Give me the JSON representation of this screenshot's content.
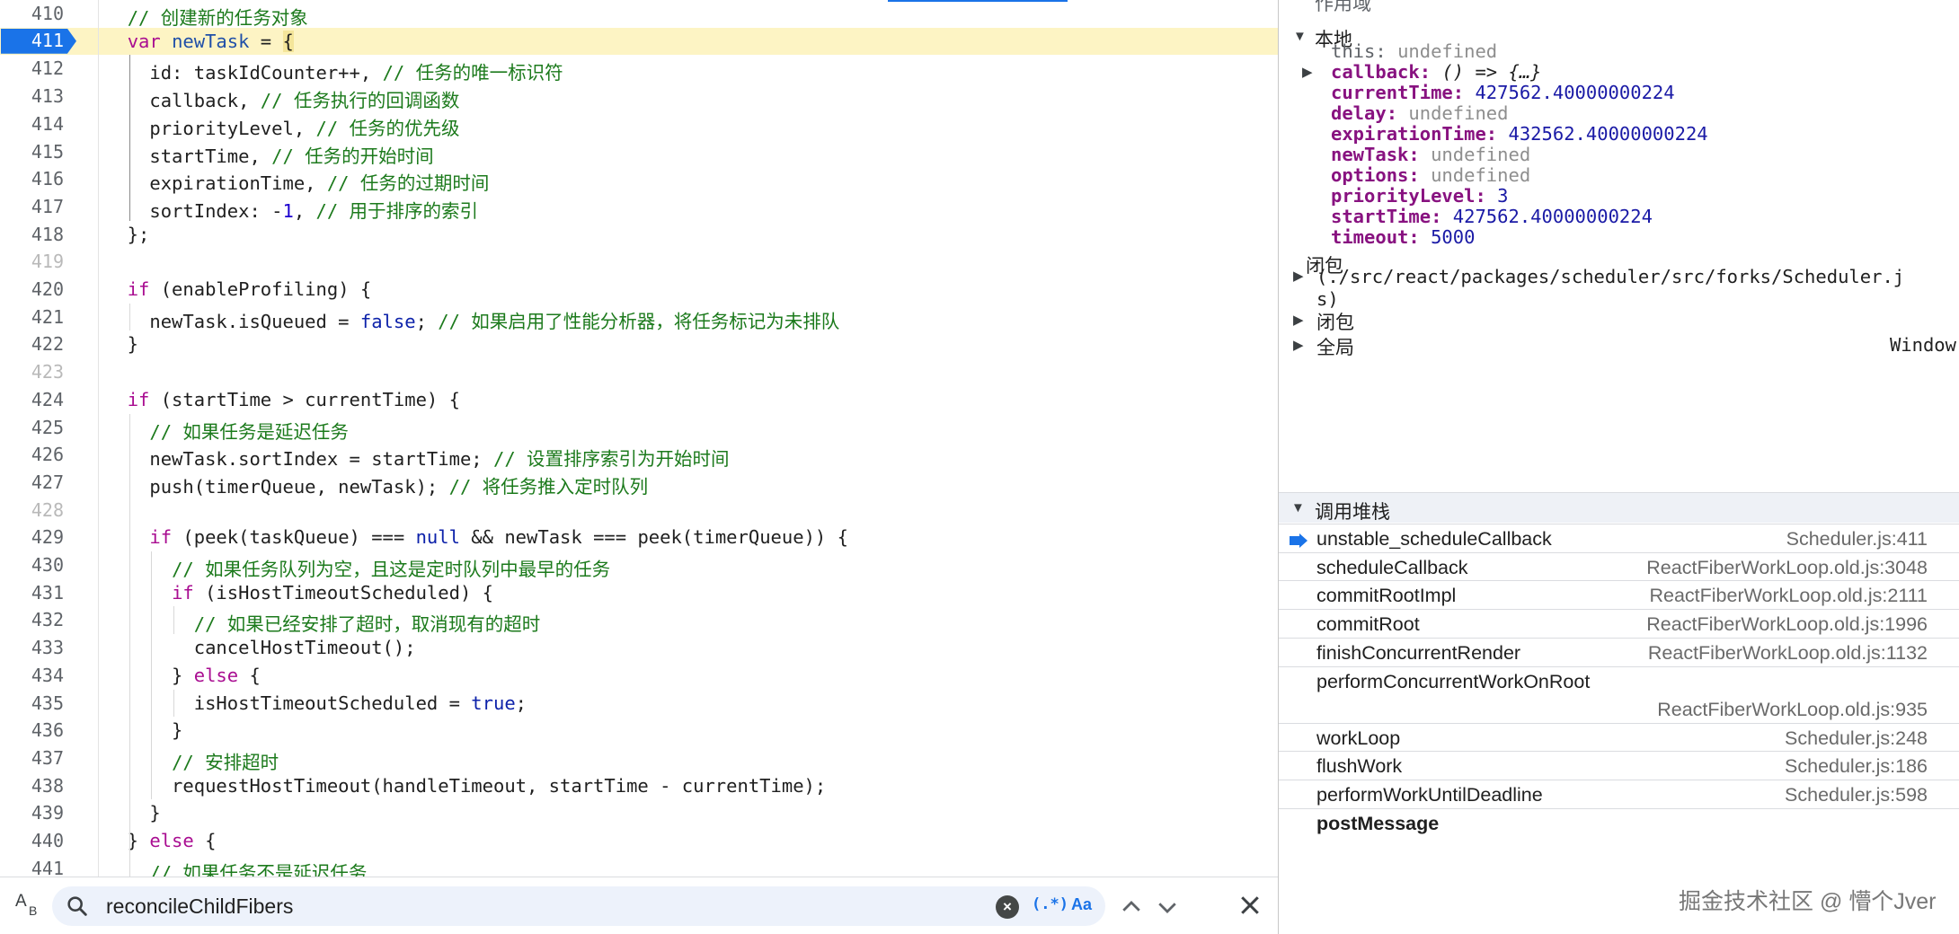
{
  "editor": {
    "paused_line": "411",
    "lines": [
      {
        "ln": "410",
        "code": [
          {
            "t": "  ",
            "c": ""
          },
          {
            "t": "// 创建新的任务对象",
            "c": "cmt"
          }
        ]
      },
      {
        "ln": "411",
        "code": [
          {
            "t": "  ",
            "c": ""
          },
          {
            "t": "var",
            "c": "kw"
          },
          {
            "t": " ",
            "c": ""
          },
          {
            "t": "newTask",
            "c": "vr"
          },
          {
            "t": " = ",
            "c": ""
          },
          {
            "t": "{",
            "c": "brace-hl"
          }
        ]
      },
      {
        "ln": "412",
        "code": [
          {
            "t": "    id: taskIdCounter++, ",
            "c": ""
          },
          {
            "t": "// 任务的唯一标识符",
            "c": "cmt"
          }
        ]
      },
      {
        "ln": "413",
        "code": [
          {
            "t": "    callback, ",
            "c": ""
          },
          {
            "t": "// 任务执行的回调函数",
            "c": "cmt"
          }
        ]
      },
      {
        "ln": "414",
        "code": [
          {
            "t": "    priorityLevel, ",
            "c": ""
          },
          {
            "t": "// 任务的优先级",
            "c": "cmt"
          }
        ]
      },
      {
        "ln": "415",
        "code": [
          {
            "t": "    startTime, ",
            "c": ""
          },
          {
            "t": "// 任务的开始时间",
            "c": "cmt"
          }
        ]
      },
      {
        "ln": "416",
        "code": [
          {
            "t": "    expirationTime, ",
            "c": ""
          },
          {
            "t": "// 任务的过期时间",
            "c": "cmt"
          }
        ]
      },
      {
        "ln": "417",
        "code": [
          {
            "t": "    sortIndex: -",
            "c": ""
          },
          {
            "t": "1",
            "c": "num"
          },
          {
            "t": ", ",
            "c": ""
          },
          {
            "t": "// 用于排序的索引",
            "c": "cmt"
          }
        ]
      },
      {
        "ln": "418",
        "code": [
          {
            "t": "  };",
            "c": ""
          }
        ]
      },
      {
        "ln": "419",
        "code": [],
        "faint": true
      },
      {
        "ln": "420",
        "code": [
          {
            "t": "  ",
            "c": ""
          },
          {
            "t": "if",
            "c": "kw"
          },
          {
            "t": " (enableProfiling) {",
            "c": ""
          }
        ]
      },
      {
        "ln": "421",
        "code": [
          {
            "t": "    newTask.isQueued = ",
            "c": ""
          },
          {
            "t": "false",
            "c": "kwb"
          },
          {
            "t": "; ",
            "c": ""
          },
          {
            "t": "// 如果启用了性能分析器，将任务标记为未排队",
            "c": "cmt"
          }
        ]
      },
      {
        "ln": "422",
        "code": [
          {
            "t": "  }",
            "c": ""
          }
        ]
      },
      {
        "ln": "423",
        "code": [],
        "faint": true
      },
      {
        "ln": "424",
        "code": [
          {
            "t": "  ",
            "c": ""
          },
          {
            "t": "if",
            "c": "kw"
          },
          {
            "t": " (startTime > currentTime) {",
            "c": ""
          }
        ]
      },
      {
        "ln": "425",
        "code": [
          {
            "t": "    ",
            "c": ""
          },
          {
            "t": "// 如果任务是延迟任务",
            "c": "cmt"
          }
        ]
      },
      {
        "ln": "426",
        "code": [
          {
            "t": "    newTask.sortIndex = startTime; ",
            "c": ""
          },
          {
            "t": "// 设置排序索引为开始时间",
            "c": "cmt"
          }
        ]
      },
      {
        "ln": "427",
        "code": [
          {
            "t": "    push(timerQueue, newTask); ",
            "c": ""
          },
          {
            "t": "// 将任务推入定时队列",
            "c": "cmt"
          }
        ]
      },
      {
        "ln": "428",
        "code": [],
        "faint": true
      },
      {
        "ln": "429",
        "code": [
          {
            "t": "    ",
            "c": ""
          },
          {
            "t": "if",
            "c": "kw"
          },
          {
            "t": " (peek(taskQueue) === ",
            "c": ""
          },
          {
            "t": "null",
            "c": "kwb"
          },
          {
            "t": " && newTask === peek(timerQueue)) {",
            "c": ""
          }
        ]
      },
      {
        "ln": "430",
        "code": [
          {
            "t": "      ",
            "c": ""
          },
          {
            "t": "// 如果任务队列为空，且这是定时队列中最早的任务",
            "c": "cmt"
          }
        ]
      },
      {
        "ln": "431",
        "code": [
          {
            "t": "      ",
            "c": ""
          },
          {
            "t": "if",
            "c": "kw"
          },
          {
            "t": " (isHostTimeoutScheduled) {",
            "c": ""
          }
        ]
      },
      {
        "ln": "432",
        "code": [
          {
            "t": "        ",
            "c": ""
          },
          {
            "t": "// 如果已经安排了超时，取消现有的超时",
            "c": "cmt"
          }
        ]
      },
      {
        "ln": "433",
        "code": [
          {
            "t": "        cancelHostTimeout();",
            "c": ""
          }
        ]
      },
      {
        "ln": "434",
        "code": [
          {
            "t": "      } ",
            "c": ""
          },
          {
            "t": "else",
            "c": "kw"
          },
          {
            "t": " {",
            "c": ""
          }
        ]
      },
      {
        "ln": "435",
        "code": [
          {
            "t": "        isHostTimeoutScheduled = ",
            "c": ""
          },
          {
            "t": "true",
            "c": "kwb"
          },
          {
            "t": ";",
            "c": ""
          }
        ]
      },
      {
        "ln": "436",
        "code": [
          {
            "t": "      }",
            "c": ""
          }
        ]
      },
      {
        "ln": "437",
        "code": [
          {
            "t": "      ",
            "c": ""
          },
          {
            "t": "// 安排超时",
            "c": "cmt"
          }
        ]
      },
      {
        "ln": "438",
        "code": [
          {
            "t": "      requestHostTimeout(handleTimeout, startTime - currentTime);",
            "c": ""
          }
        ]
      },
      {
        "ln": "439",
        "code": [
          {
            "t": "    }",
            "c": ""
          }
        ]
      },
      {
        "ln": "440",
        "code": [
          {
            "t": "  } ",
            "c": ""
          },
          {
            "t": "else",
            "c": "kw"
          },
          {
            "t": " {",
            "c": ""
          }
        ]
      },
      {
        "ln": "441",
        "code": [
          {
            "t": "    ",
            "c": ""
          },
          {
            "t": "// 如果任务不是延迟任务",
            "c": "cmt"
          }
        ]
      }
    ]
  },
  "search": {
    "value": "reconcileChildFibers",
    "regex_label": "(.*)",
    "case_label": "Aa",
    "ab_top": "A",
    "ab_bottom": "B"
  },
  "scope": {
    "header_cut": "作用域",
    "local_label": "本地",
    "local": [
      {
        "name": "this",
        "value": "undefined",
        "kind": "undef",
        "plain": true
      },
      {
        "name": "callback",
        "value": "() => {…}",
        "kind": "fn",
        "expandable": true
      },
      {
        "name": "currentTime",
        "value": "427562.40000000224",
        "kind": "num"
      },
      {
        "name": "delay",
        "value": "undefined",
        "kind": "undef"
      },
      {
        "name": "expirationTime",
        "value": "432562.40000000224",
        "kind": "num"
      },
      {
        "name": "newTask",
        "value": "undefined",
        "kind": "undef"
      },
      {
        "name": "options",
        "value": "undefined",
        "kind": "undef"
      },
      {
        "name": "priorityLevel",
        "value": "3",
        "kind": "num"
      },
      {
        "name": "startTime",
        "value": "427562.40000000224",
        "kind": "num"
      },
      {
        "name": "timeout",
        "value": "5000",
        "kind": "num"
      }
    ],
    "closure_label": "闭包",
    "closure_path_1": "(./src/react/packages/scheduler/src/forks/Scheduler.j",
    "closure_path_2": "s)",
    "closure2_label": "闭包",
    "global_label": "全局",
    "global_value": "Window"
  },
  "callstack": {
    "label": "调用堆栈",
    "frames": [
      {
        "fn": "unstable_scheduleCallback",
        "loc": "Scheduler.js:411",
        "current": true
      },
      {
        "fn": "scheduleCallback",
        "loc": "ReactFiberWorkLoop.old.js:3048"
      },
      {
        "fn": "commitRootImpl",
        "loc": "ReactFiberWorkLoop.old.js:2111"
      },
      {
        "fn": "commitRoot",
        "loc": "ReactFiberWorkLoop.old.js:1996"
      },
      {
        "fn": "finishConcurrentRender",
        "loc": "ReactFiberWorkLoop.old.js:1132"
      },
      {
        "fn": "performConcurrentWorkOnRoot",
        "loc": "ReactFiberWorkLoop.old.js:935",
        "wrap": true
      },
      {
        "fn": "workLoop",
        "loc": "Scheduler.js:248"
      },
      {
        "fn": "flushWork",
        "loc": "Scheduler.js:186"
      },
      {
        "fn": "performWorkUntilDeadline",
        "loc": "Scheduler.js:598"
      },
      {
        "fn": "postMessage",
        "loc": "",
        "bold": true
      }
    ]
  },
  "watermark": "掘金技术社区 @ 懵个Jver",
  "colors": {
    "accent": "#1a73e8",
    "paused_line": "#fdf4c4"
  }
}
